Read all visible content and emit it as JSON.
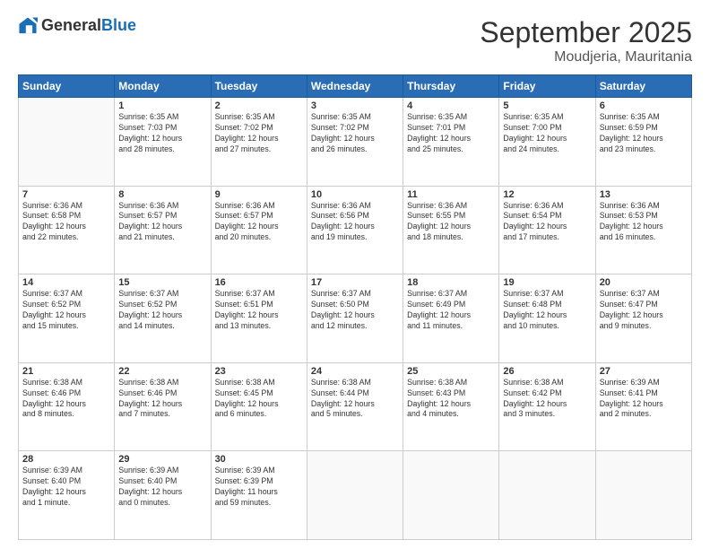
{
  "header": {
    "logo": {
      "general": "General",
      "blue": "Blue"
    },
    "title": "September 2025",
    "location": "Moudjeria, Mauritania"
  },
  "calendar": {
    "days_of_week": [
      "Sunday",
      "Monday",
      "Tuesday",
      "Wednesday",
      "Thursday",
      "Friday",
      "Saturday"
    ],
    "weeks": [
      [
        {
          "day": "",
          "detail": ""
        },
        {
          "day": "1",
          "detail": "Sunrise: 6:35 AM\nSunset: 7:03 PM\nDaylight: 12 hours\nand 28 minutes."
        },
        {
          "day": "2",
          "detail": "Sunrise: 6:35 AM\nSunset: 7:02 PM\nDaylight: 12 hours\nand 27 minutes."
        },
        {
          "day": "3",
          "detail": "Sunrise: 6:35 AM\nSunset: 7:02 PM\nDaylight: 12 hours\nand 26 minutes."
        },
        {
          "day": "4",
          "detail": "Sunrise: 6:35 AM\nSunset: 7:01 PM\nDaylight: 12 hours\nand 25 minutes."
        },
        {
          "day": "5",
          "detail": "Sunrise: 6:35 AM\nSunset: 7:00 PM\nDaylight: 12 hours\nand 24 minutes."
        },
        {
          "day": "6",
          "detail": "Sunrise: 6:35 AM\nSunset: 6:59 PM\nDaylight: 12 hours\nand 23 minutes."
        }
      ],
      [
        {
          "day": "7",
          "detail": "Sunrise: 6:36 AM\nSunset: 6:58 PM\nDaylight: 12 hours\nand 22 minutes."
        },
        {
          "day": "8",
          "detail": "Sunrise: 6:36 AM\nSunset: 6:57 PM\nDaylight: 12 hours\nand 21 minutes."
        },
        {
          "day": "9",
          "detail": "Sunrise: 6:36 AM\nSunset: 6:57 PM\nDaylight: 12 hours\nand 20 minutes."
        },
        {
          "day": "10",
          "detail": "Sunrise: 6:36 AM\nSunset: 6:56 PM\nDaylight: 12 hours\nand 19 minutes."
        },
        {
          "day": "11",
          "detail": "Sunrise: 6:36 AM\nSunset: 6:55 PM\nDaylight: 12 hours\nand 18 minutes."
        },
        {
          "day": "12",
          "detail": "Sunrise: 6:36 AM\nSunset: 6:54 PM\nDaylight: 12 hours\nand 17 minutes."
        },
        {
          "day": "13",
          "detail": "Sunrise: 6:36 AM\nSunset: 6:53 PM\nDaylight: 12 hours\nand 16 minutes."
        }
      ],
      [
        {
          "day": "14",
          "detail": "Sunrise: 6:37 AM\nSunset: 6:52 PM\nDaylight: 12 hours\nand 15 minutes."
        },
        {
          "day": "15",
          "detail": "Sunrise: 6:37 AM\nSunset: 6:52 PM\nDaylight: 12 hours\nand 14 minutes."
        },
        {
          "day": "16",
          "detail": "Sunrise: 6:37 AM\nSunset: 6:51 PM\nDaylight: 12 hours\nand 13 minutes."
        },
        {
          "day": "17",
          "detail": "Sunrise: 6:37 AM\nSunset: 6:50 PM\nDaylight: 12 hours\nand 12 minutes."
        },
        {
          "day": "18",
          "detail": "Sunrise: 6:37 AM\nSunset: 6:49 PM\nDaylight: 12 hours\nand 11 minutes."
        },
        {
          "day": "19",
          "detail": "Sunrise: 6:37 AM\nSunset: 6:48 PM\nDaylight: 12 hours\nand 10 minutes."
        },
        {
          "day": "20",
          "detail": "Sunrise: 6:37 AM\nSunset: 6:47 PM\nDaylight: 12 hours\nand 9 minutes."
        }
      ],
      [
        {
          "day": "21",
          "detail": "Sunrise: 6:38 AM\nSunset: 6:46 PM\nDaylight: 12 hours\nand 8 minutes."
        },
        {
          "day": "22",
          "detail": "Sunrise: 6:38 AM\nSunset: 6:46 PM\nDaylight: 12 hours\nand 7 minutes."
        },
        {
          "day": "23",
          "detail": "Sunrise: 6:38 AM\nSunset: 6:45 PM\nDaylight: 12 hours\nand 6 minutes."
        },
        {
          "day": "24",
          "detail": "Sunrise: 6:38 AM\nSunset: 6:44 PM\nDaylight: 12 hours\nand 5 minutes."
        },
        {
          "day": "25",
          "detail": "Sunrise: 6:38 AM\nSunset: 6:43 PM\nDaylight: 12 hours\nand 4 minutes."
        },
        {
          "day": "26",
          "detail": "Sunrise: 6:38 AM\nSunset: 6:42 PM\nDaylight: 12 hours\nand 3 minutes."
        },
        {
          "day": "27",
          "detail": "Sunrise: 6:39 AM\nSunset: 6:41 PM\nDaylight: 12 hours\nand 2 minutes."
        }
      ],
      [
        {
          "day": "28",
          "detail": "Sunrise: 6:39 AM\nSunset: 6:40 PM\nDaylight: 12 hours\nand 1 minute."
        },
        {
          "day": "29",
          "detail": "Sunrise: 6:39 AM\nSunset: 6:40 PM\nDaylight: 12 hours\nand 0 minutes."
        },
        {
          "day": "30",
          "detail": "Sunrise: 6:39 AM\nSunset: 6:39 PM\nDaylight: 11 hours\nand 59 minutes."
        },
        {
          "day": "",
          "detail": ""
        },
        {
          "day": "",
          "detail": ""
        },
        {
          "day": "",
          "detail": ""
        },
        {
          "day": "",
          "detail": ""
        }
      ]
    ]
  }
}
